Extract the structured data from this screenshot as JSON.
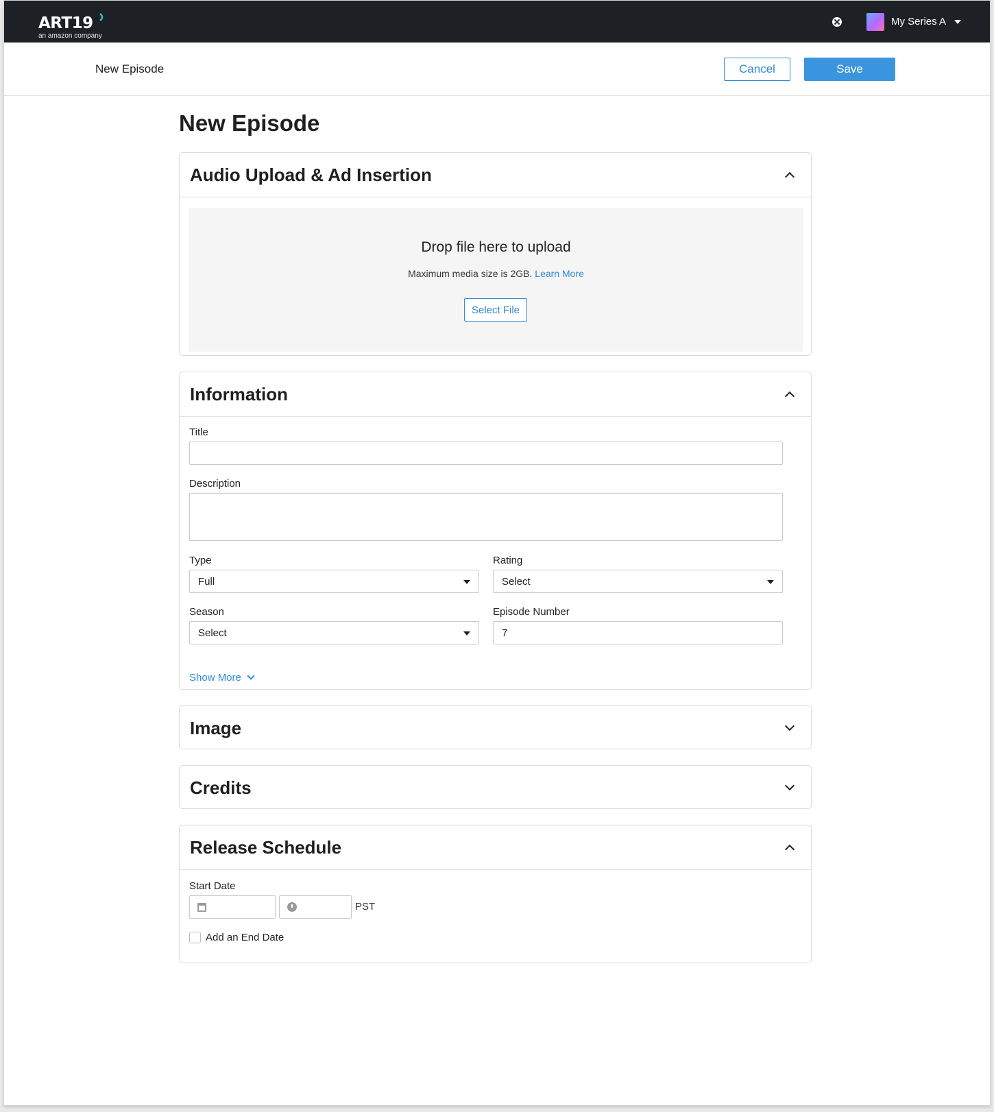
{
  "brand": {
    "logo_main": "ART19",
    "logo_sub": "an amazon company"
  },
  "nav": {
    "series_name": "My Series A",
    "help_icon": "close-circle-icon"
  },
  "subheader": {
    "title": "New Episode",
    "cancel_label": "Cancel",
    "save_label": "Save"
  },
  "page": {
    "title": "New Episode"
  },
  "upload_panel": {
    "title": "Audio Upload & Ad Insertion",
    "drop_title": "Drop file here to upload",
    "drop_sub": "Maximum media size is 2GB.",
    "learn_more": "Learn More",
    "select_file": "Select File"
  },
  "information": {
    "title": "Information",
    "title_label": "Title",
    "title_value": "",
    "description_label": "Description",
    "description_value": "",
    "type_label": "Type",
    "type_value": "Full",
    "rating_label": "Rating",
    "rating_value": "Select",
    "season_label": "Season",
    "season_value": "Select",
    "episode_number_label": "Episode Number",
    "episode_number_value": "7",
    "show_more": "Show More"
  },
  "image_panel": {
    "title": "Image"
  },
  "credits_panel": {
    "title": "Credits"
  },
  "release": {
    "title": "Release Schedule",
    "start_date_label": "Start Date",
    "date_value": "",
    "time_value": "",
    "timezone": "PST",
    "end_date_label": "Add an End Date"
  },
  "colors": {
    "accent": "#2f8ad8",
    "nav_bg": "#1d2125",
    "save_bg": "#3b94de"
  }
}
